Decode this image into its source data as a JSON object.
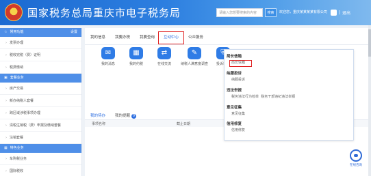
{
  "header": {
    "site_title": "国家税务总局重庆市电子税务局",
    "search_placeholder": "请输入您想要搜索的内容",
    "search_button": "搜索",
    "mid_text": "欢迎您，重庆某某某某有限公司",
    "user_dropdown_label": "▼",
    "logout": "退出",
    "separator": "|"
  },
  "sidebar": {
    "sections": [
      {
        "title": "常用功能",
        "action": "设置",
        "items": [
          "发票办理",
          "税收完税（费）证明",
          "税费缴纳"
        ]
      },
      {
        "title": "套餐业务",
        "items": [
          "房产交易",
          "新办纳税人套餐",
          "跨区域涉税事项办理",
          "清税注销税（费）申报及缴纳套餐",
          "注销套餐"
        ]
      },
      {
        "title": "特色业务",
        "items": [
          "车购税业务",
          "国际税收"
        ]
      }
    ]
  },
  "main": {
    "tabs": [
      "我的信息",
      "我要办税",
      "我要查询",
      "互动中心",
      "公众服务"
    ],
    "active_tab_index": 3,
    "icons": [
      {
        "label": "我的消息",
        "icon": "message-icon"
      },
      {
        "label": "我的约税",
        "icon": "calendar-icon"
      },
      {
        "label": "在线交流",
        "icon": "chat-icon"
      },
      {
        "label": "纳税人满意度调查",
        "icon": "survey-icon"
      },
      {
        "label": "投诉举报",
        "icon": "shield-icon"
      }
    ],
    "bottom_tabs": [
      "我的待办",
      "我的提醒"
    ],
    "reminder_count": "0",
    "table_headers": [
      "事项名称",
      "截止日期"
    ]
  },
  "popup": {
    "groups": [
      {
        "title": "局长信箱",
        "subs": [
          "局长信箱"
        ]
      },
      {
        "title": "纳服投诉",
        "subs": [
          "纳服投诉"
        ]
      },
      {
        "title": "违法举报",
        "subs": [
          "税务违法行为检举",
          "税务干部违纪违法举报"
        ]
      },
      {
        "title": "意见征集",
        "subs": [
          "意见征集"
        ]
      },
      {
        "title": "信用修复",
        "subs": [
          "信用修复"
        ]
      }
    ]
  },
  "assistant": {
    "label": "在线咨询"
  }
}
